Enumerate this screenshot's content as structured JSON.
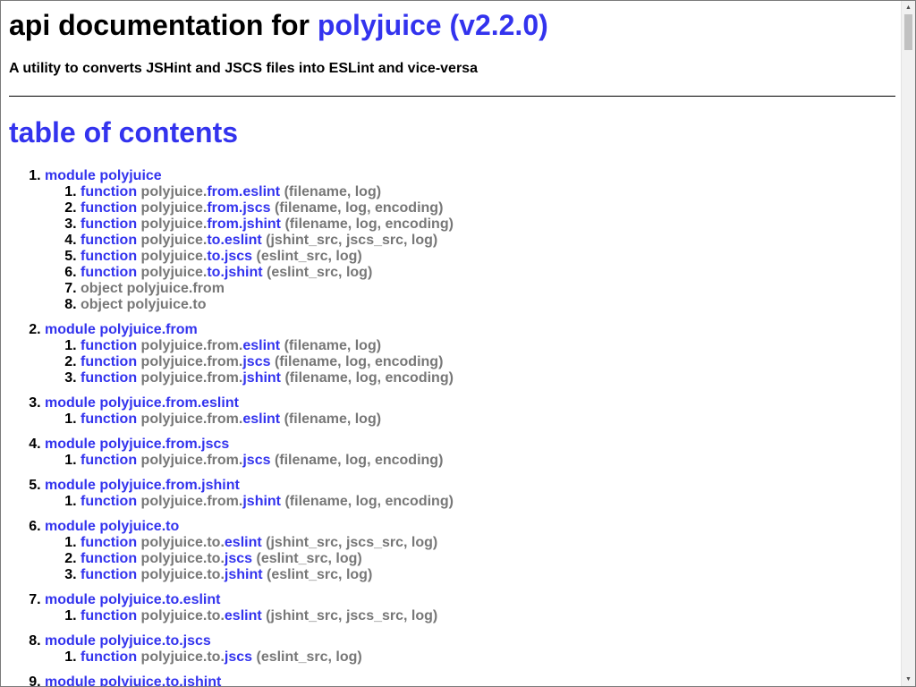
{
  "header": {
    "title_prefix": "api documentation for ",
    "title_link": "polyjuice (v2.2.0)",
    "description": "A utility to converts JSHint and JSCS files into ESLint and vice-versa"
  },
  "toc": {
    "heading": "table of contents",
    "modules": [
      {
        "label": "module polyjuice",
        "items": [
          {
            "kind": "function",
            "prefix": "polyjuice.",
            "name": "from.eslint",
            "args": "(filename, log)"
          },
          {
            "kind": "function",
            "prefix": "polyjuice.",
            "name": "from.jscs",
            "args": "(filename, log, encoding)"
          },
          {
            "kind": "function",
            "prefix": "polyjuice.",
            "name": "from.jshint",
            "args": "(filename, log, encoding)"
          },
          {
            "kind": "function",
            "prefix": "polyjuice.",
            "name": "to.eslint",
            "args": "(jshint_src, jscs_src, log)"
          },
          {
            "kind": "function",
            "prefix": "polyjuice.",
            "name": "to.jscs",
            "args": "(eslint_src, log)"
          },
          {
            "kind": "function",
            "prefix": "polyjuice.",
            "name": "to.jshint",
            "args": "(eslint_src, log)"
          },
          {
            "kind": "object",
            "text": "object polyjuice.from"
          },
          {
            "kind": "object",
            "text": "object polyjuice.to"
          }
        ]
      },
      {
        "label": "module polyjuice.from",
        "items": [
          {
            "kind": "function",
            "prefix": "polyjuice.from.",
            "name": "eslint",
            "args": "(filename, log)"
          },
          {
            "kind": "function",
            "prefix": "polyjuice.from.",
            "name": "jscs",
            "args": "(filename, log, encoding)"
          },
          {
            "kind": "function",
            "prefix": "polyjuice.from.",
            "name": "jshint",
            "args": "(filename, log, encoding)"
          }
        ]
      },
      {
        "label": "module polyjuice.from.eslint",
        "items": [
          {
            "kind": "function",
            "prefix": "polyjuice.from.",
            "name": "eslint",
            "args": "(filename, log)"
          }
        ]
      },
      {
        "label": "module polyjuice.from.jscs",
        "items": [
          {
            "kind": "function",
            "prefix": "polyjuice.from.",
            "name": "jscs",
            "args": "(filename, log, encoding)"
          }
        ]
      },
      {
        "label": "module polyjuice.from.jshint",
        "items": [
          {
            "kind": "function",
            "prefix": "polyjuice.from.",
            "name": "jshint",
            "args": "(filename, log, encoding)"
          }
        ]
      },
      {
        "label": "module polyjuice.to",
        "items": [
          {
            "kind": "function",
            "prefix": "polyjuice.to.",
            "name": "eslint",
            "args": "(jshint_src, jscs_src, log)"
          },
          {
            "kind": "function",
            "prefix": "polyjuice.to.",
            "name": "jscs",
            "args": "(eslint_src, log)"
          },
          {
            "kind": "function",
            "prefix": "polyjuice.to.",
            "name": "jshint",
            "args": "(eslint_src, log)"
          }
        ]
      },
      {
        "label": "module polyjuice.to.eslint",
        "items": [
          {
            "kind": "function",
            "prefix": "polyjuice.to.",
            "name": "eslint",
            "args": "(jshint_src, jscs_src, log)"
          }
        ]
      },
      {
        "label": "module polyjuice.to.jscs",
        "items": [
          {
            "kind": "function",
            "prefix": "polyjuice.to.",
            "name": "jscs",
            "args": "(eslint_src, log)"
          }
        ]
      },
      {
        "label": "module polyjuice.to.jshint",
        "items": []
      }
    ]
  },
  "icons": {
    "scroll_up": "scroll-up-arrow-icon",
    "scroll_down": "scroll-down-arrow-icon"
  },
  "colors": {
    "link": "#3333ee",
    "muted": "#777777",
    "text": "#000000"
  }
}
